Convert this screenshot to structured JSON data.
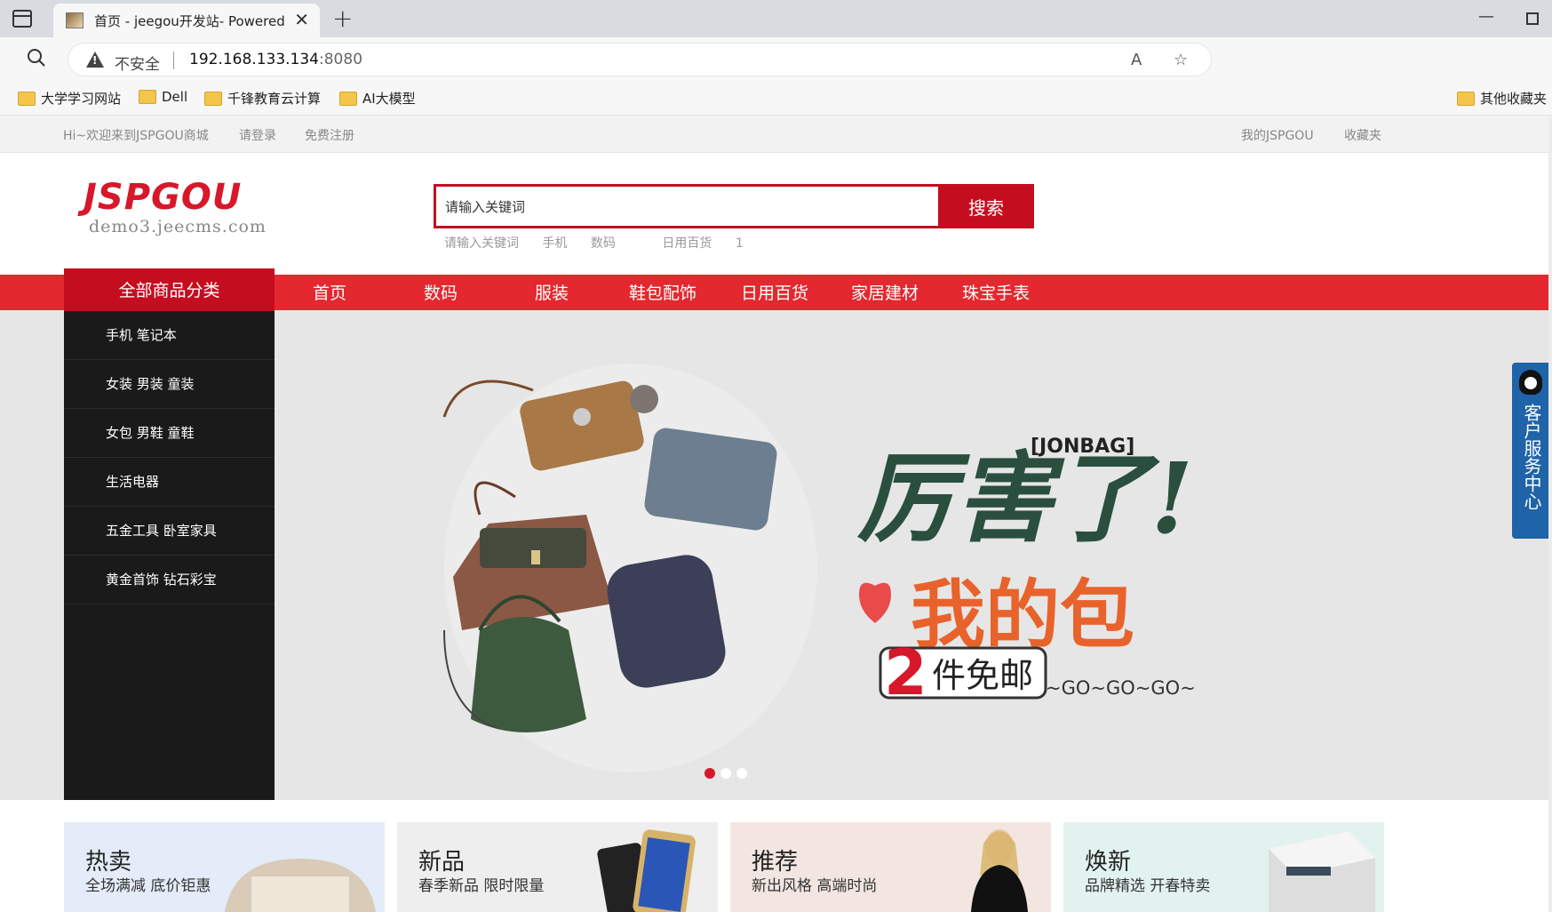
{
  "browser": {
    "tab_title": "首页 - jeegou开发站- Powered by",
    "insecure_label": "不安全",
    "url_host": "192.168.133.134",
    "url_port": ":8080",
    "bookmarks": [
      "大学学习网站",
      "Dell",
      "千锋教育云计算",
      "AI大模型"
    ],
    "other_bookmarks": "其他收藏夹"
  },
  "toplinks": {
    "welcome": "Hi~欢迎来到JSPGOU商城",
    "login": "请登录",
    "register": "免费注册",
    "my_account": "我的JSPGOU",
    "favorites": "收藏夹"
  },
  "logo": {
    "main": "JSPGOU",
    "sub": "demo3.jeecms.com"
  },
  "search": {
    "placeholder": "请输入关键词",
    "button": "搜索",
    "hotwords": [
      "请输入关键词",
      "手机",
      "数码",
      "日用百货",
      "1"
    ]
  },
  "category": {
    "header": "全部商品分类",
    "items": [
      "手机   笔记本",
      "女装   男装   童装",
      "女包   男鞋   童鞋",
      "生活电器",
      "五金工具   卧室家具",
      "黄金首饰   钻石彩宝"
    ]
  },
  "nav": [
    "首页",
    "数码",
    "服装",
    "鞋包配饰",
    "日用百货",
    "家居建材",
    "珠宝手表"
  ],
  "banner": {
    "brand": "[JONBAG]",
    "line1": "厉害了!",
    "line2": "我的包",
    "badge_num": "2",
    "badge_text": "件免邮",
    "tail": "~GO~GO~GO~",
    "active_dot": 0
  },
  "kefu": {
    "label": "客户服务中心"
  },
  "promos": [
    {
      "title": "热卖",
      "sub": "全场满减 底价钜惠",
      "bg": "#e3ecf8"
    },
    {
      "title": "新品",
      "sub": "春季新品 限时限量",
      "bg": "#eeeeee"
    },
    {
      "title": "推荐",
      "sub": "新出风格 高端时尚",
      "bg": "#f3e6e0"
    },
    {
      "title": "焕新",
      "sub": "品牌精选 开春特卖",
      "bg": "#e2f2ef"
    }
  ],
  "colors": {
    "brand_red": "#e3282f",
    "dark_red": "#c40e20",
    "category_bg": "#1a1a1a"
  }
}
